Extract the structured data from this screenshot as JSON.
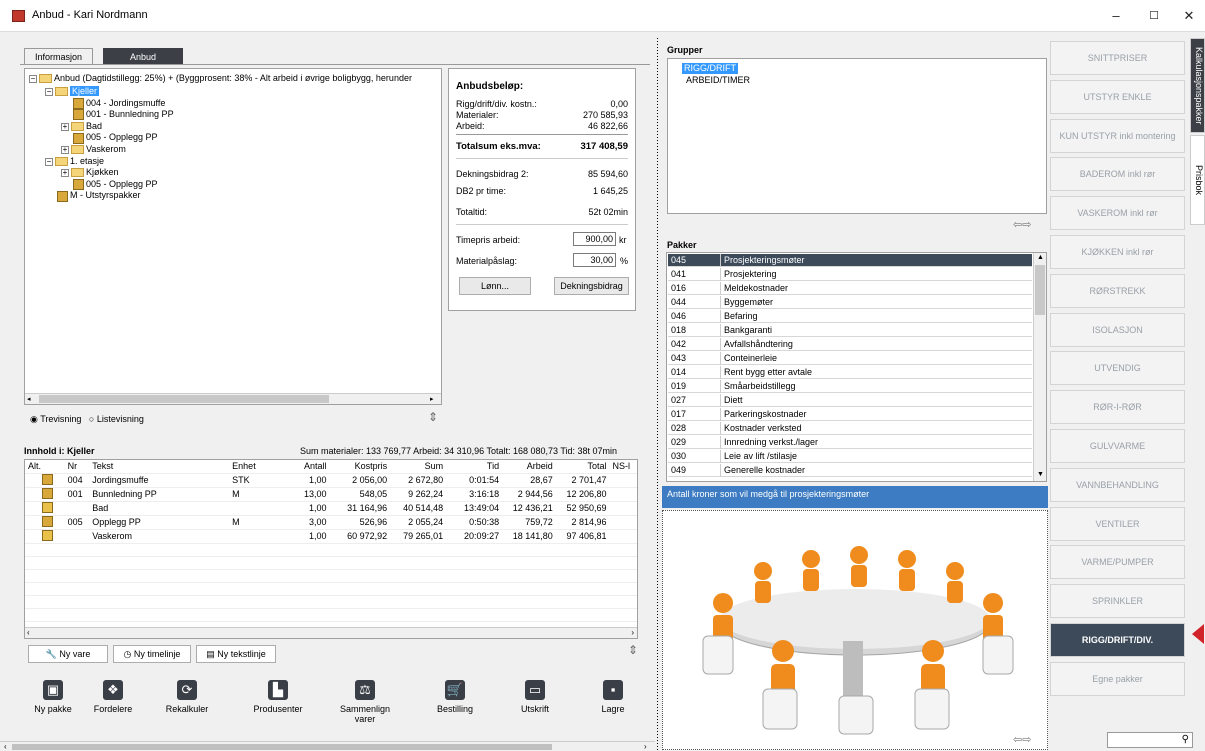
{
  "window": {
    "title": "Anbud - Kari Nordmann",
    "min": "–",
    "max": "☐",
    "close": "✕"
  },
  "tabs": [
    "Informasjon",
    "Anbud"
  ],
  "tree": {
    "root": "Anbud (Dagtidstillegg: 25%) + (Byggprosent: 38% - Alt arbeid i øvrige boligbygg, herunder",
    "items": [
      {
        "label": "Kjeller",
        "type": "folder",
        "level": 1,
        "exp": "−",
        "selected": true
      },
      {
        "label": "004 - Jordingsmuffe",
        "type": "pkg",
        "level": 2
      },
      {
        "label": "001 - Bunnledning PP",
        "type": "pkg",
        "level": 2
      },
      {
        "label": "Bad",
        "type": "folder",
        "level": 2,
        "exp": "+"
      },
      {
        "label": "005 - Opplegg PP",
        "type": "pkg",
        "level": 2
      },
      {
        "label": "Vaskerom",
        "type": "folder",
        "level": 2,
        "exp": "+"
      },
      {
        "label": "1. etasje",
        "type": "folder",
        "level": 1,
        "exp": "−"
      },
      {
        "label": "Kjøkken",
        "type": "folder",
        "level": 2,
        "exp": "+"
      },
      {
        "label": "005 - Opplegg PP",
        "type": "pkg",
        "level": 2
      },
      {
        "label": "M - Utstyrspakker",
        "type": "pkg",
        "level": 1
      }
    ]
  },
  "summary": {
    "title": "Anbudsbeløp:",
    "rigg_label": "Rigg/drift/div. kostn.:",
    "rigg": "0,00",
    "mat_label": "Materialer:",
    "mat": "270 585,93",
    "arb_label": "Arbeid:",
    "arb": "46 822,66",
    "total_label": "Totalsum eks.mva:",
    "total": "317 408,59",
    "db_label": "Dekningsbidrag 2:",
    "db": "85 594,60",
    "db2_label": "DB2 pr time:",
    "db2": "1 645,25",
    "tid_label": "Totaltid:",
    "tid": "52t 02min",
    "timepris_label": "Timepris arbeid:",
    "timepris": "900,00",
    "timepris_unit": "kr",
    "mat_pasl_label": "Materialpåslag:",
    "mat_pasl": "30,00",
    "mat_pasl_unit": "%",
    "lonn_btn": "Lønn...",
    "db_btn": "Dekningsbidrag"
  },
  "view": {
    "tree": "Trevisning",
    "list": "Listevisning"
  },
  "content": {
    "title": "Innhold i: Kjeller",
    "stats": "Sum materialer: 133 769,77  Arbeid: 34 310,96  Totalt: 168 080,73  Tid: 38t 07min",
    "headers": [
      "Alt.",
      "Nr",
      "Tekst",
      "Enhet",
      "Antall",
      "Kostpris",
      "Sum",
      "Tid",
      "Arbeid",
      "Total",
      "NS-l"
    ],
    "rows": [
      {
        "nr": "004",
        "tekst": "Jordingsmuffe",
        "enhet": "STK",
        "antall": "1,00",
        "kost": "2 056,00",
        "sum": "2 672,80",
        "tid": "0:01:54",
        "arbeid": "28,67",
        "total": "2 701,47",
        "icon": "pkg"
      },
      {
        "nr": "001",
        "tekst": "Bunnledning PP",
        "enhet": "M",
        "antall": "13,00",
        "kost": "548,05",
        "sum": "9 262,24",
        "tid": "3:16:18",
        "arbeid": "2 944,56",
        "total": "12 206,80",
        "icon": "pkg"
      },
      {
        "nr": "",
        "tekst": "Bad",
        "enhet": "",
        "antall": "1,00",
        "kost": "31 164,96",
        "sum": "40 514,48",
        "tid": "13:49:04",
        "arbeid": "12 436,21",
        "total": "52 950,69",
        "icon": "flag"
      },
      {
        "nr": "005",
        "tekst": "Opplegg PP",
        "enhet": "M",
        "antall": "3,00",
        "kost": "526,96",
        "sum": "2 055,24",
        "tid": "0:50:38",
        "arbeid": "759,72",
        "total": "2 814,96",
        "icon": "pkg"
      },
      {
        "nr": "",
        "tekst": "Vaskerom",
        "enhet": "",
        "antall": "1,00",
        "kost": "60 972,92",
        "sum": "79 265,01",
        "tid": "20:09:27",
        "arbeid": "18 141,80",
        "total": "97 406,81",
        "icon": "flag"
      }
    ]
  },
  "bottom_buttons": [
    "Ny vare",
    "Ny timelinje",
    "Ny tekstlinje"
  ],
  "toolbar": [
    "Ny pakke",
    "Fordelere",
    "Rekalkuler",
    "Produsenter",
    "Sammenlign varer",
    "Bestilling",
    "Utskrift",
    "Lagre"
  ],
  "grupper": {
    "title": "Grupper",
    "items": [
      "RIGG/DRIFT",
      "ARBEID/TIMER"
    ]
  },
  "pakker": {
    "title": "Pakker",
    "rows": [
      [
        "045",
        "Prosjekteringsmøter"
      ],
      [
        "041",
        "Prosjektering"
      ],
      [
        "016",
        "Meldekostnader"
      ],
      [
        "044",
        "Byggemøter"
      ],
      [
        "046",
        "Befaring"
      ],
      [
        "018",
        "Bankgaranti"
      ],
      [
        "042",
        "Avfallshåndtering"
      ],
      [
        "043",
        "Conteinerleie"
      ],
      [
        "014",
        "Rent bygg etter avtale"
      ],
      [
        "019",
        "Småarbeidstillegg"
      ],
      [
        "027",
        "Diett"
      ],
      [
        "017",
        "Parkeringskostnader"
      ],
      [
        "028",
        "Kostnader verksted"
      ],
      [
        "029",
        "Innredning verkst./lager"
      ],
      [
        "030",
        "Leie av lift /stilasje"
      ],
      [
        "049",
        "Generelle kostnader"
      ]
    ],
    "description": "Antall kroner som vil medgå til prosjekteringsmøter"
  },
  "right_buttons": [
    "SNITTPRISER",
    "UTSTYR  ENKLE",
    "KUN UTSTYR inkl montering",
    "BADEROM inkl rør",
    "VASKEROM inkl rør",
    "KJØKKEN inkl rør",
    "RØRSTREKK",
    "ISOLASJON",
    "UTVENDIG",
    "RØR-I-RØR",
    "GULVVARME",
    "VANNBEHANDLING",
    "VENTILER",
    "VARME/PUMPER",
    "SPRINKLER",
    "RIGG/DRIFT/DIV.",
    "Egne pakker"
  ],
  "side_tabs": [
    "Kalkulasjonspakker",
    "Prisbok"
  ],
  "colors": {
    "selected": "#3399ff",
    "active_button": "#3c4a5a",
    "marker": "#d0232a",
    "desc_bar": "#3d7cc2"
  }
}
